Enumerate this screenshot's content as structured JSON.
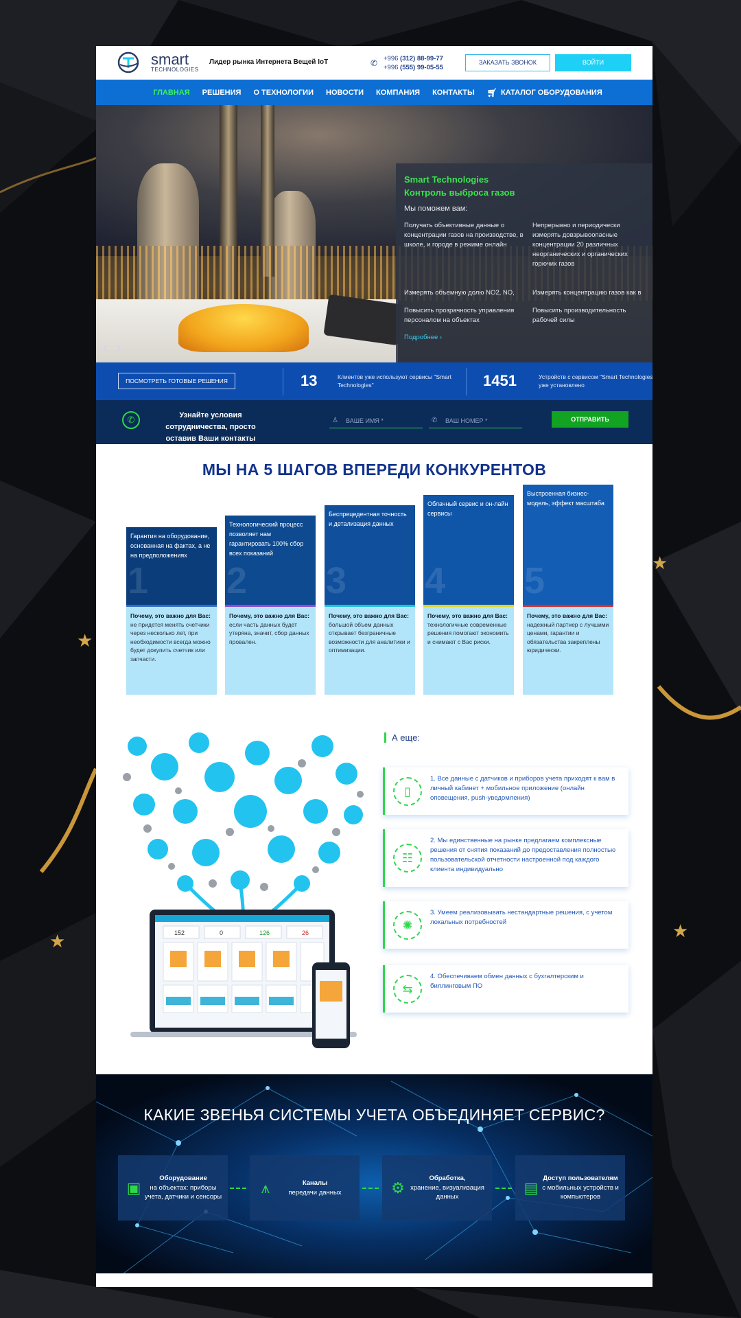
{
  "colors": {
    "accent_green": "#2ed84b",
    "nav_blue": "#0d6fd3",
    "title_blue": "#12338c",
    "cyan": "#1ed0f5"
  },
  "header": {
    "logo_name": "smart",
    "logo_sub": "TECHNOLOGIES",
    "tagline": "Лидер рынка Интернета Вещей IoT",
    "phone_1_prefix": "+996",
    "phone_1": "(312) 88-99-77",
    "phone_2_prefix": "+996",
    "phone_2": "(555) 99-05-55",
    "call_button": "ЗАКАЗАТЬ ЗВОНОК",
    "login_button": "ВОЙТИ"
  },
  "nav": {
    "items": [
      "ГЛАВНАЯ",
      "РЕШЕНИЯ",
      "О ТЕХНОЛОГИИ",
      "НОВОСТИ",
      "КОМПАНИЯ",
      "КОНТАКТЫ"
    ],
    "catalog": "КАТАЛОГ ОБОРУДОВАНИЯ",
    "cart_icon": "cart-icon"
  },
  "hero": {
    "title_line1": "Smart Technologies",
    "title_line2": "Контроль выброса газов",
    "subtitle": "Мы поможем вам:",
    "cells": [
      "Получать объективные данные о концентрации газов на производстве, в школе, и городе в режиме онлайн",
      "Непрерывно и периодически измерять довзрывоопасные концентрации 20 различных неорганических и органических горючих газов",
      "Измерять объемную долю NO2, NO,",
      "Измерять концентрацию газов как в",
      "Повысить прозрачность управления персоналом на объектах",
      "Повысить производительность рабочей силы"
    ],
    "more_link": "Подробнее"
  },
  "stats": {
    "button": "ПОСМОТРЕТЬ ГОТОВЫЕ РЕШЕНИЯ",
    "num_1": "13",
    "text_1": "Клиентов уже используют сервисы \"Smart Technologies\"",
    "num_2": "1451",
    "text_2": "Устройств с сервисом \"Smart Technologies\" уже установлено"
  },
  "contact": {
    "text": "Узнайте условия сотрудничества, просто оставив Ваши контакты",
    "name_placeholder": "ВАШЕ ИМЯ *",
    "phone_placeholder": "ВАШ НОМЕР *",
    "send_button": "ОТПРАВИТЬ"
  },
  "steps": {
    "title": "МЫ НА 5 ШАГОВ ВПЕРЕДИ КОНКУРЕНТОВ",
    "why_label": "Почему, это важно для Вас:",
    "items": [
      {
        "num": "1",
        "title": "Гарантия на оборудование, основанная на фактах, а не на предположениях",
        "why": "не придется менять счетчики через несколько лет, при необходимости всегда можно будет докупить счетчик или запчасти.",
        "color": "#0a3d7a",
        "line": "#2f6dc8"
      },
      {
        "num": "2",
        "title": "Технологический процесс позволяет нам гарантировать 100% сбор всех показаний",
        "why": "если часть данных будет утеряна, значит, сбор данных провален.",
        "color": "#0d4a90",
        "line": "#8a4bd6"
      },
      {
        "num": "3",
        "title": "Беспрецедентная точность и детализация данных",
        "why": "большой объем данных открывает безграничные возможности для аналитики и оптимизации.",
        "color": "#0f4f9c",
        "line": "#21c1d8"
      },
      {
        "num": "4",
        "title": "Облачный сервис и он-лайн сервисы",
        "why": "технологичные современные решения помогают экономить и снимают с Вас риски.",
        "color": "#0f55a8",
        "line": "#e0d62a"
      },
      {
        "num": "5",
        "title": "Выстроенная бизнес-модель, эффект масштаба",
        "why": "надежный партнер с лучшими ценами, гарантии и обязательства закреплены юридически.",
        "color": "#135db4",
        "line": "#d62e2e"
      }
    ]
  },
  "features": {
    "title": "А еще:",
    "items": [
      {
        "text": "1. Все данные с датчиков и приборов учета приходят к вам в личный кабинет + мобильное приложение (онлайн оповещения, push-уведомления)",
        "icon": "mobile-icon",
        "glyph": "▯"
      },
      {
        "text": "2. Мы единственные на рынке предлагаем комплексные решения от снятия показаний до предоставления полностью пользовательской отчетности настроенной под каждого клиента индивидуально",
        "icon": "report-icon",
        "glyph": "☷"
      },
      {
        "text": "3. Умеем реализовывать нестандартные решения, с учетом локальных потребностей",
        "icon": "bulb-icon",
        "glyph": "✺"
      },
      {
        "text": "4. Обеспечиваем обмен данных с бухгалтерским и биллинговым ПО",
        "icon": "exchange-icon",
        "glyph": "⇆"
      }
    ],
    "dashboard_values": [
      "152",
      "0",
      "126",
      "26"
    ]
  },
  "network": {
    "title": "КАКИЕ ЗВЕНЬЯ СИСТЕМЫ УЧЕТА ОБЪЕДИНЯЕТ СЕРВИС?",
    "cards": [
      {
        "bold": "Оборудование",
        "rest": "на объектах: приборы учета, датчики и сенсоры",
        "icon": "equipment-icon",
        "glyph": "▣"
      },
      {
        "bold": "Каналы",
        "rest": "передачи данных",
        "icon": "antenna-icon",
        "glyph": "⩚"
      },
      {
        "bold": "Обработка,",
        "rest": "хранение, визуализация данных",
        "icon": "processing-icon",
        "glyph": "⚙"
      },
      {
        "bold": "Доступ пользователям",
        "rest": "с мобильных устройств и компьютеров",
        "icon": "devices-icon",
        "glyph": "▤"
      }
    ]
  }
}
